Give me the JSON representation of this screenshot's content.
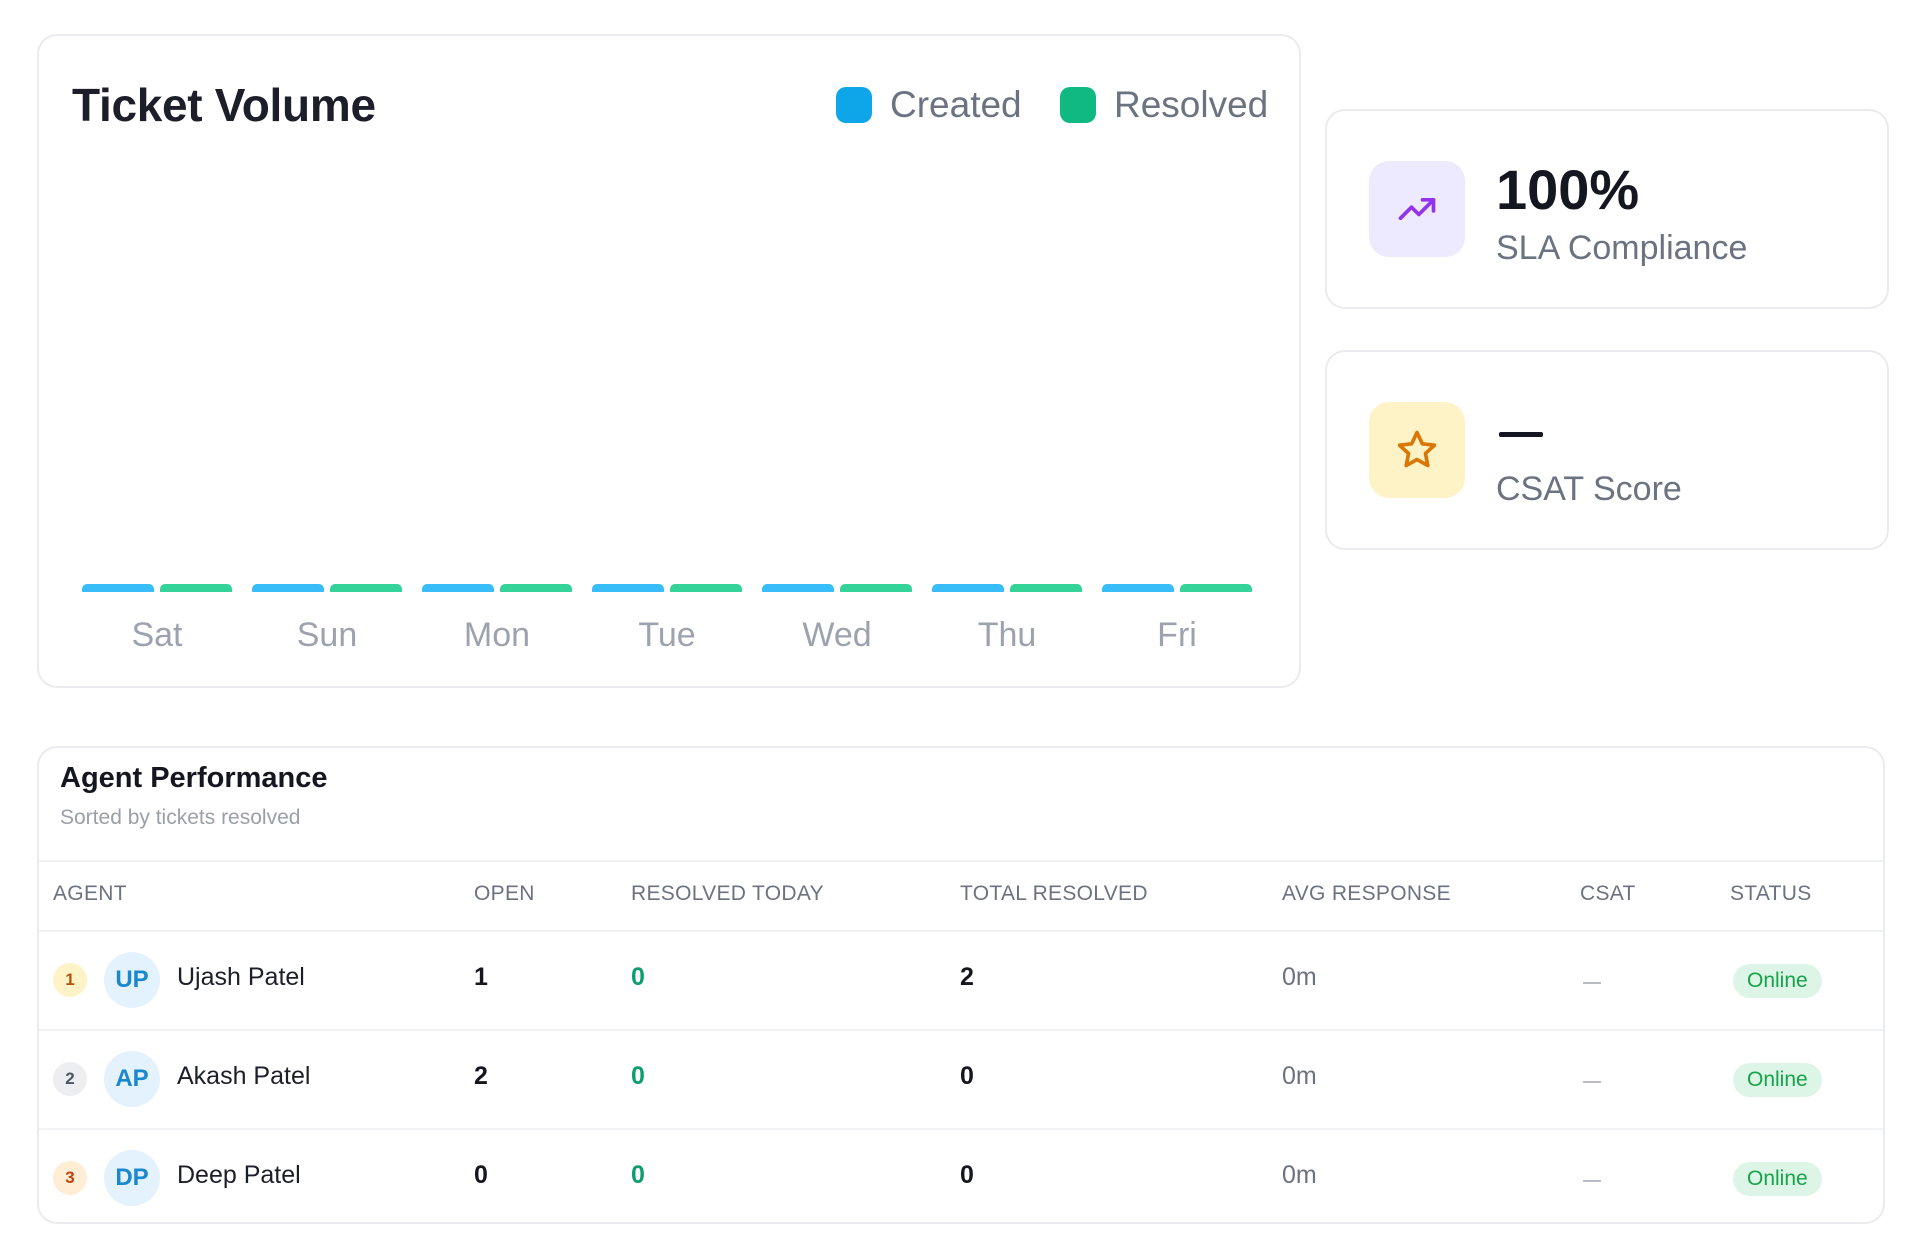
{
  "ticket_volume": {
    "title": "Ticket Volume",
    "legend": [
      {
        "label": "Created",
        "color": "#0ea5e9"
      },
      {
        "label": "Resolved",
        "color": "#10b981"
      }
    ]
  },
  "chart_data": {
    "type": "bar",
    "title": "Ticket Volume",
    "categories": [
      "Sat",
      "Sun",
      "Mon",
      "Tue",
      "Wed",
      "Thu",
      "Fri"
    ],
    "series": [
      {
        "name": "Created",
        "color": "#38bdf8",
        "values": [
          0,
          0,
          0,
          0,
          0,
          0,
          0
        ]
      },
      {
        "name": "Resolved",
        "color": "#34d399",
        "values": [
          0,
          0,
          0,
          0,
          0,
          0,
          0
        ]
      }
    ],
    "legend": "top-right",
    "grid": false
  },
  "kpis": {
    "sla": {
      "value": "100%",
      "label": "SLA Compliance",
      "icon": "trending-up-icon",
      "icon_color": "#9333ea",
      "icon_bg": "#ede9fe"
    },
    "csat": {
      "value": "—",
      "label": "CSAT Score",
      "icon": "star-icon",
      "icon_color": "#d97706",
      "icon_bg": "#fef3c7"
    }
  },
  "agents": {
    "title": "Agent Performance",
    "subtitle": "Sorted by tickets resolved",
    "columns": [
      "AGENT",
      "OPEN",
      "RESOLVED TODAY",
      "TOTAL RESOLVED",
      "AVG RESPONSE",
      "CSAT",
      "STATUS"
    ],
    "rows": [
      {
        "rank": "1",
        "initials": "UP",
        "name": "Ujash Patel",
        "open": "1",
        "resolved_today": "0",
        "total_resolved": "2",
        "avg_response": "0m",
        "csat": "—",
        "status": "Online"
      },
      {
        "rank": "2",
        "initials": "AP",
        "name": "Akash Patel",
        "open": "2",
        "resolved_today": "0",
        "total_resolved": "0",
        "avg_response": "0m",
        "csat": "—",
        "status": "Online"
      },
      {
        "rank": "3",
        "initials": "DP",
        "name": "Deep Patel",
        "open": "0",
        "resolved_today": "0",
        "total_resolved": "0",
        "avg_response": "0m",
        "csat": "—",
        "status": "Online"
      }
    ]
  }
}
